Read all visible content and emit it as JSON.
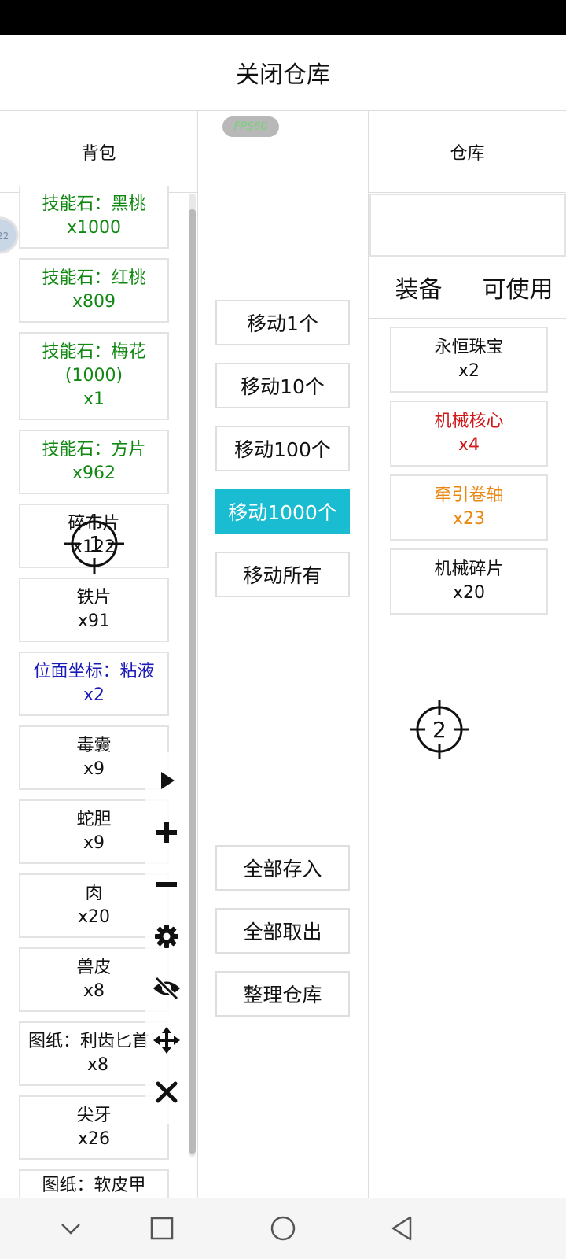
{
  "header": {
    "title": "关闭仓库"
  },
  "fps_badge": "FPS60",
  "bag": {
    "title": "背包",
    "items": [
      {
        "name": "技能石：黑桃",
        "qty": "x1000",
        "color": "#118811"
      },
      {
        "name": "技能石：红桃",
        "qty": "x809",
        "color": "#118811"
      },
      {
        "name": "技能石：梅花",
        "sub": "(1000)",
        "qty": "x1",
        "color": "#118811"
      },
      {
        "name": "技能石：方片",
        "qty": "x962",
        "color": "#118811"
      },
      {
        "name": "碎布片",
        "qty": "x122",
        "color": "#111111"
      },
      {
        "name": "铁片",
        "qty": "x91",
        "color": "#111111"
      },
      {
        "name": "位面坐标：粘液",
        "qty": "x2",
        "color": "#1a1ab8"
      },
      {
        "name": "毒囊",
        "qty": "x9",
        "color": "#111111"
      },
      {
        "name": "蛇胆",
        "qty": "x9",
        "color": "#111111"
      },
      {
        "name": "肉",
        "qty": "x20",
        "color": "#111111"
      },
      {
        "name": "兽皮",
        "qty": "x8",
        "color": "#111111"
      },
      {
        "name": "图纸：利齿匕首",
        "qty": "x8",
        "color": "#111111"
      },
      {
        "name": "尖牙",
        "qty": "x26",
        "color": "#111111"
      },
      {
        "name": "图纸：软皮甲",
        "qty": "",
        "color": "#111111"
      }
    ]
  },
  "actions": {
    "move_buttons": [
      "移动1个",
      "移动10个",
      "移动100个",
      "移动1000个",
      "移动所有"
    ],
    "active_index": 3,
    "bottom_buttons": [
      "全部存入",
      "全部取出",
      "整理仓库"
    ]
  },
  "warehouse": {
    "title": "仓库",
    "tabs": [
      "装备",
      "可使用"
    ],
    "items": [
      {
        "name": "永恒珠宝",
        "qty": "x2",
        "color": "#111111"
      },
      {
        "name": "机械核心",
        "qty": "x4",
        "color": "#d01818"
      },
      {
        "name": "牵引卷轴",
        "qty": "x23",
        "color": "#e88812"
      },
      {
        "name": "机械碎片",
        "qty": "x20",
        "color": "#111111"
      }
    ]
  },
  "toolbar": {
    "icons": [
      "play-icon",
      "plus-icon",
      "minus-icon",
      "gear-icon",
      "eye-off-icon",
      "move-icon",
      "close-icon"
    ]
  },
  "crosshairs": [
    "1",
    "2"
  ],
  "side_bubble": "22",
  "navbar": {
    "icons": [
      "chevron-down-icon",
      "square-icon",
      "circle-icon",
      "back-triangle-icon"
    ]
  },
  "colors": {
    "accent": "#19bcd0",
    "green": "#118811",
    "blue": "#1a1ab8",
    "red": "#d01818",
    "orange": "#e88812"
  }
}
